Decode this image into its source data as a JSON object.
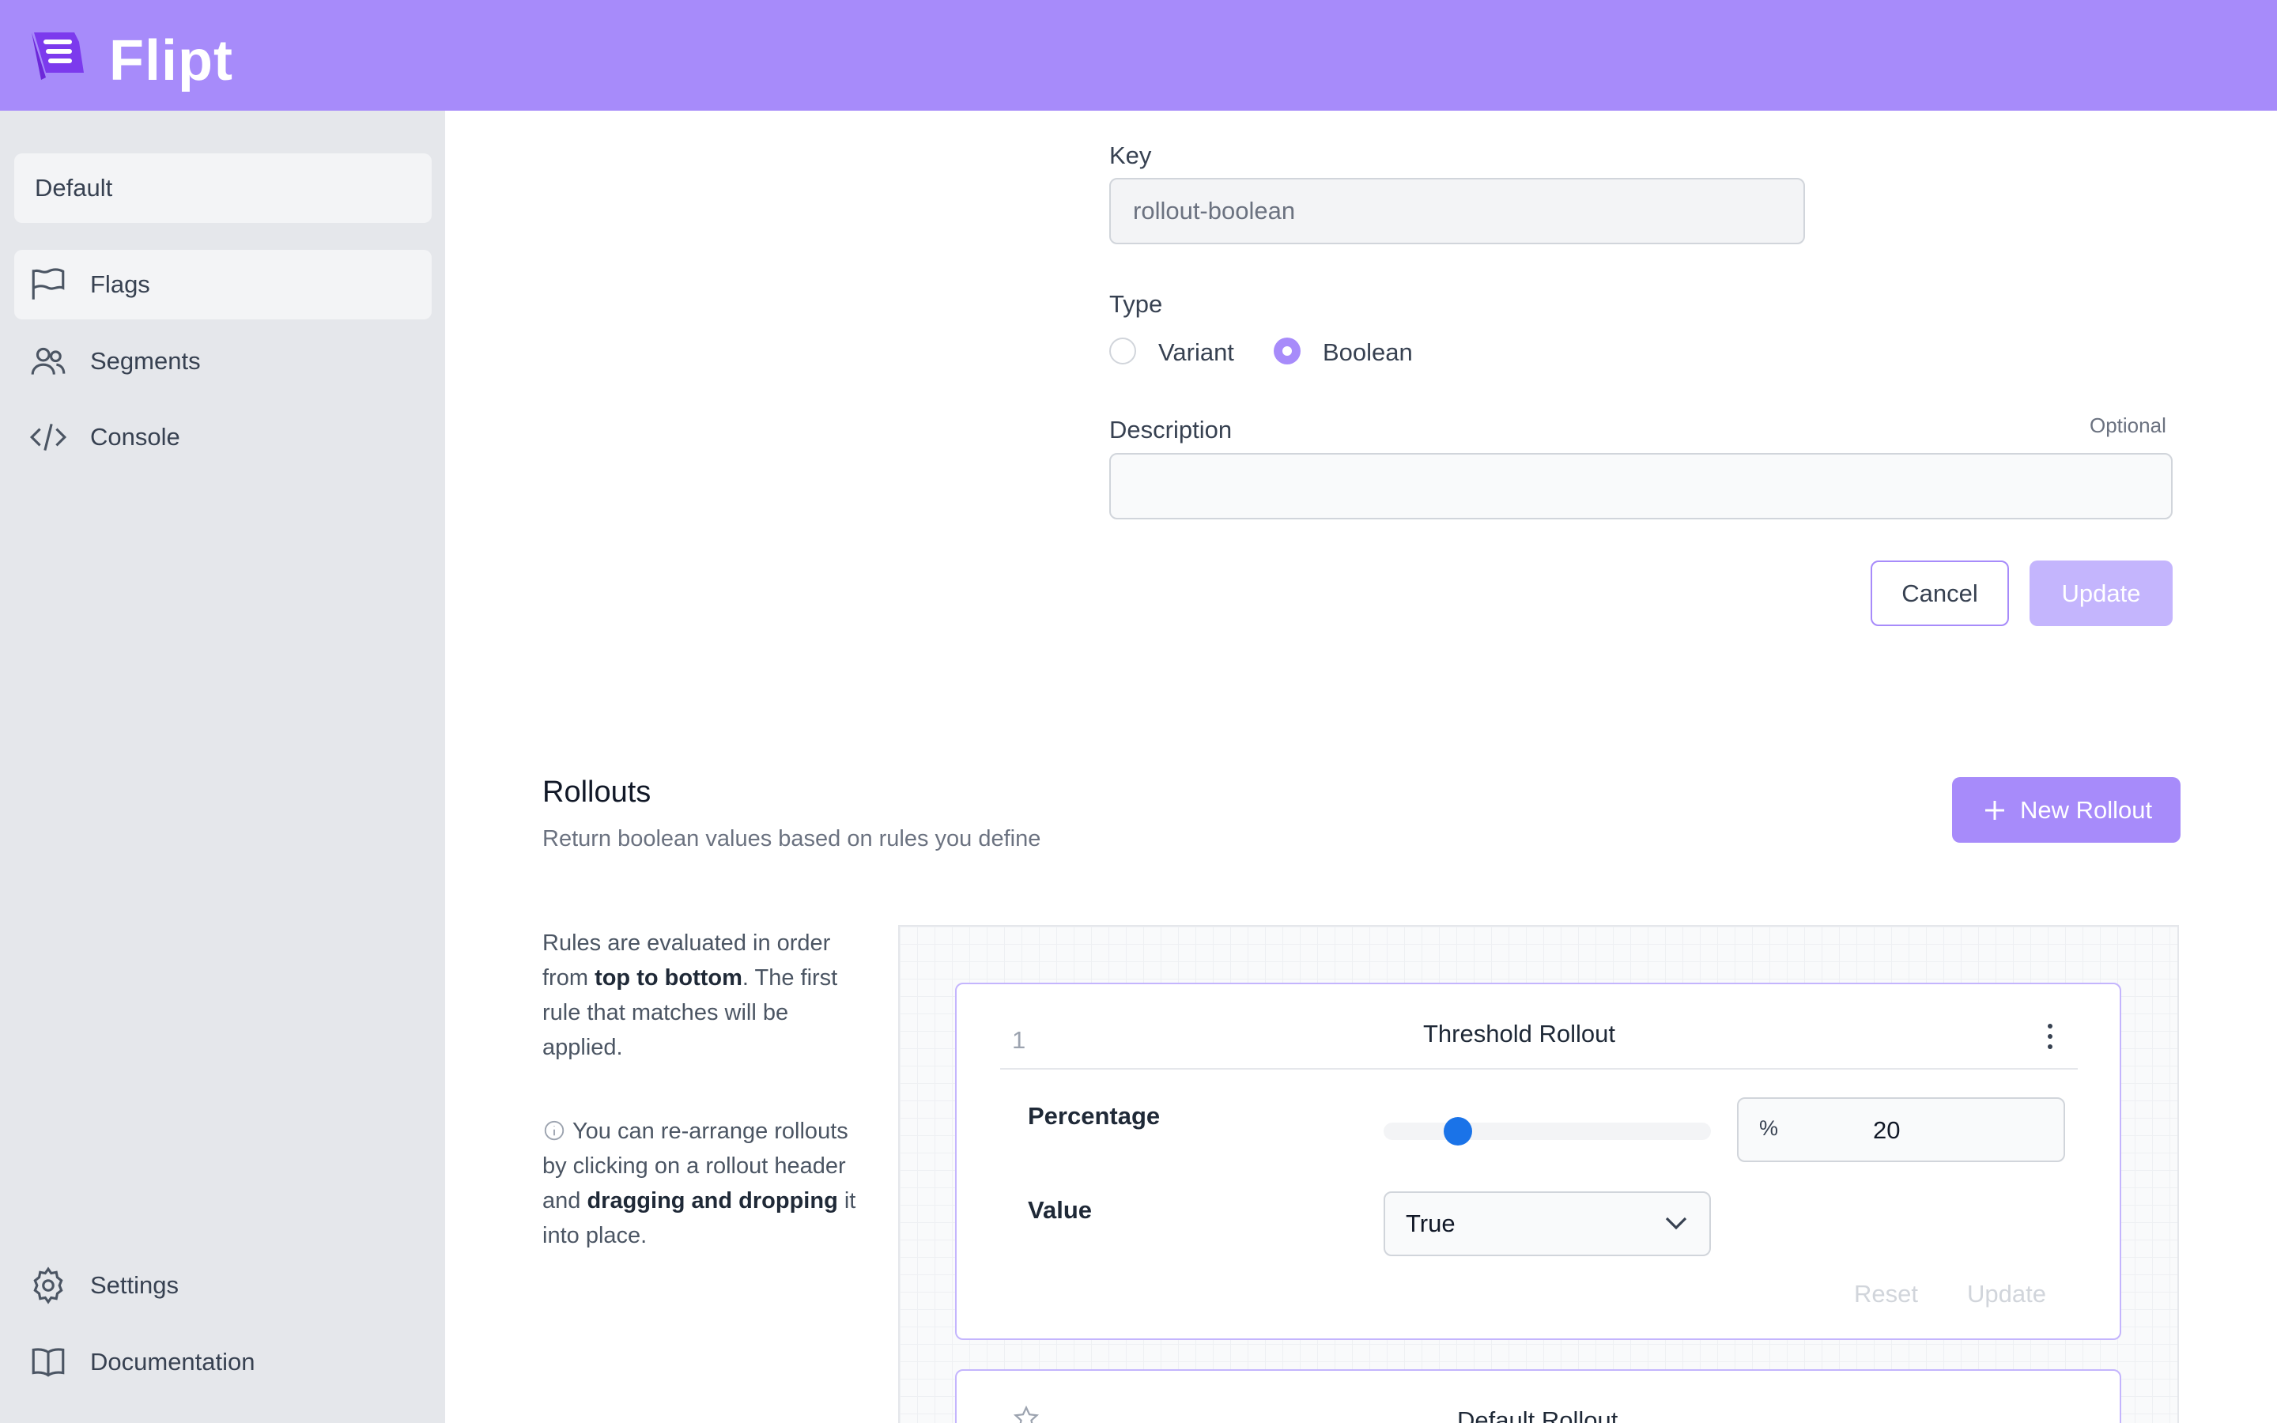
{
  "app": {
    "name": "Flipt"
  },
  "sidebar": {
    "namespace": "Default",
    "items": [
      {
        "label": "Flags",
        "icon": "flag-icon",
        "active": true
      },
      {
        "label": "Segments",
        "icon": "users-icon",
        "active": false
      },
      {
        "label": "Console",
        "icon": "code-icon",
        "active": false
      }
    ],
    "footer": [
      {
        "label": "Settings",
        "icon": "gear-icon"
      },
      {
        "label": "Documentation",
        "icon": "book-icon"
      }
    ]
  },
  "form": {
    "key_label": "Key",
    "key_value": "rollout-boolean",
    "type_label": "Type",
    "type_options": [
      "Variant",
      "Boolean"
    ],
    "type_selected": "Boolean",
    "description_label": "Description",
    "description_hint": "Optional",
    "description_value": "",
    "cancel_label": "Cancel",
    "update_label": "Update"
  },
  "rollouts": {
    "title": "Rollouts",
    "subtitle": "Return boolean values based on rules you define",
    "new_button": "New Rollout",
    "help_1_a": "Rules are evaluated in order from ",
    "help_1_b": "top to bottom",
    "help_1_c": ". The first rule that matches will be applied.",
    "help_2_a": "You can re-arrange rollouts by clicking on a rollout header and ",
    "help_2_b": "dragging and dropping",
    "help_2_c": " it into place.",
    "items": [
      {
        "rank": "1",
        "title": "Threshold Rollout",
        "percentage_label": "Percentage",
        "percentage_symbol": "%",
        "percentage_value": "20",
        "percentage_fraction": 0.2,
        "value_label": "Value",
        "value_selected": "True",
        "reset_label": "Reset",
        "update_label": "Update"
      },
      {
        "title": "Default Rollout"
      }
    ]
  },
  "colors": {
    "brand": "#a78bfa",
    "brand_light": "#c4b5fd",
    "slider_thumb": "#1a73e8"
  }
}
